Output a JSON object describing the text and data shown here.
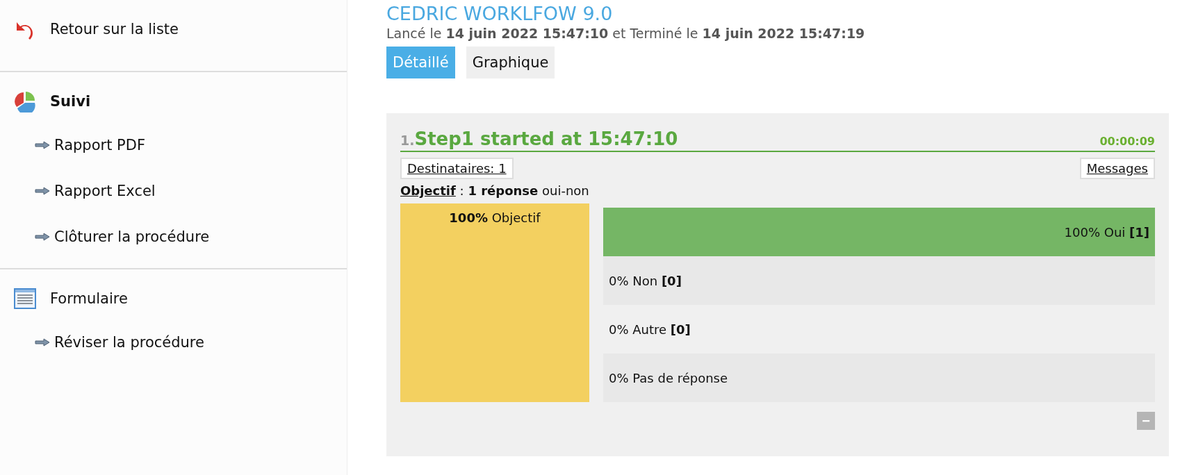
{
  "sidebar": {
    "sections": [
      {
        "kind": "back",
        "label": "Retour sur la liste",
        "bold": false
      },
      {
        "kind": "chart",
        "label": "Suivi",
        "bold": true,
        "children": [
          {
            "label": "Rapport PDF"
          },
          {
            "label": "Rapport Excel"
          },
          {
            "label": "Clôturer la procédure"
          }
        ]
      },
      {
        "kind": "form",
        "label": "Formulaire",
        "bold": false,
        "children": [
          {
            "label": "Réviser la procédure"
          }
        ]
      }
    ]
  },
  "header": {
    "title": "CEDRIC WORKLFOW 9.0",
    "subtitle": "Lancé le **14 juin 2022 15:47:10** et Terminé le **14 juin 2022 15:47:19**"
  },
  "tabs": [
    {
      "label": "Détaillé",
      "selected": true
    },
    {
      "label": "Graphique",
      "selected": false
    }
  ],
  "step": {
    "number": "1.",
    "title": "Step1 started at 15:47:10",
    "duration": "00:00:09",
    "recipients_button": "Destinataires: 1",
    "messages_button": "Messages",
    "objective_link": "Objectif",
    "objective_text": ": **1 réponse** oui-non",
    "objective_box": "**100%** Objectif",
    "collapse_button": "−",
    "answers": [
      {
        "label": "100% Oui **[1]**",
        "level": 1
      },
      {
        "label": "0% Non **[0]**",
        "level": 0
      },
      {
        "label": "0% Autre **[0]**",
        "level": 0
      },
      {
        "label": "0% Pas de réponse",
        "level": 0
      }
    ]
  }
}
